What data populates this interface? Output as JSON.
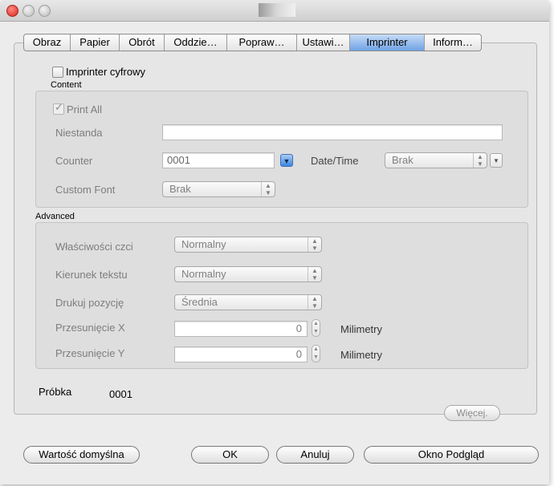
{
  "tabs": [
    {
      "label": "Obraz",
      "active": false
    },
    {
      "label": "Papier",
      "active": false
    },
    {
      "label": "Obrót",
      "active": false
    },
    {
      "label": "Oddzie…",
      "active": false
    },
    {
      "label": "Popraw…",
      "active": false
    },
    {
      "label": "Ustawi…",
      "active": false
    },
    {
      "label": "Imprinter",
      "active": true
    },
    {
      "label": "Inform…",
      "active": false
    }
  ],
  "imprinter": {
    "checkbox_label": "Imprinter cyfrowy",
    "checked": false
  },
  "content": {
    "section_label": "Content",
    "print_all": {
      "label": "Print All",
      "checked": true
    },
    "custom_text": {
      "label": "Niestanda",
      "value": ""
    },
    "counter": {
      "label": "Counter",
      "value": "0001"
    },
    "datetime": {
      "label": "Date/Time",
      "value": "Brak"
    },
    "custom_font": {
      "label": "Custom Font",
      "value": "Brak"
    }
  },
  "advanced": {
    "section_label": "Advanced",
    "attributes": {
      "label": "Właściwości czci",
      "value": "Normalny"
    },
    "direction": {
      "label": "Kierunek tekstu",
      "value": "Normalny"
    },
    "position": {
      "label": "Drukuj pozycję",
      "value": "Średnia"
    },
    "offset_x": {
      "label": "Przesunięcie X",
      "value": "0",
      "unit": "Milimetry"
    },
    "offset_y": {
      "label": "Przesunięcie Y",
      "value": "0",
      "unit": "Milimetry"
    }
  },
  "sample": {
    "label": "Próbka",
    "value": "0001"
  },
  "more_button": "Więcej.",
  "footer": {
    "defaults": "Wartość domyślna",
    "ok": "OK",
    "cancel": "Anuluj",
    "preview": "Okno Podgląd"
  },
  "icons": {
    "checkmark": "✓",
    "popup_arrows": "up-down-arrows-icon",
    "dropdown_triangle": "triangle-down-icon"
  },
  "colors": {
    "active_tab": "#6fa2e5",
    "window_bg": "#ececec",
    "close_button": "#d7261d"
  }
}
